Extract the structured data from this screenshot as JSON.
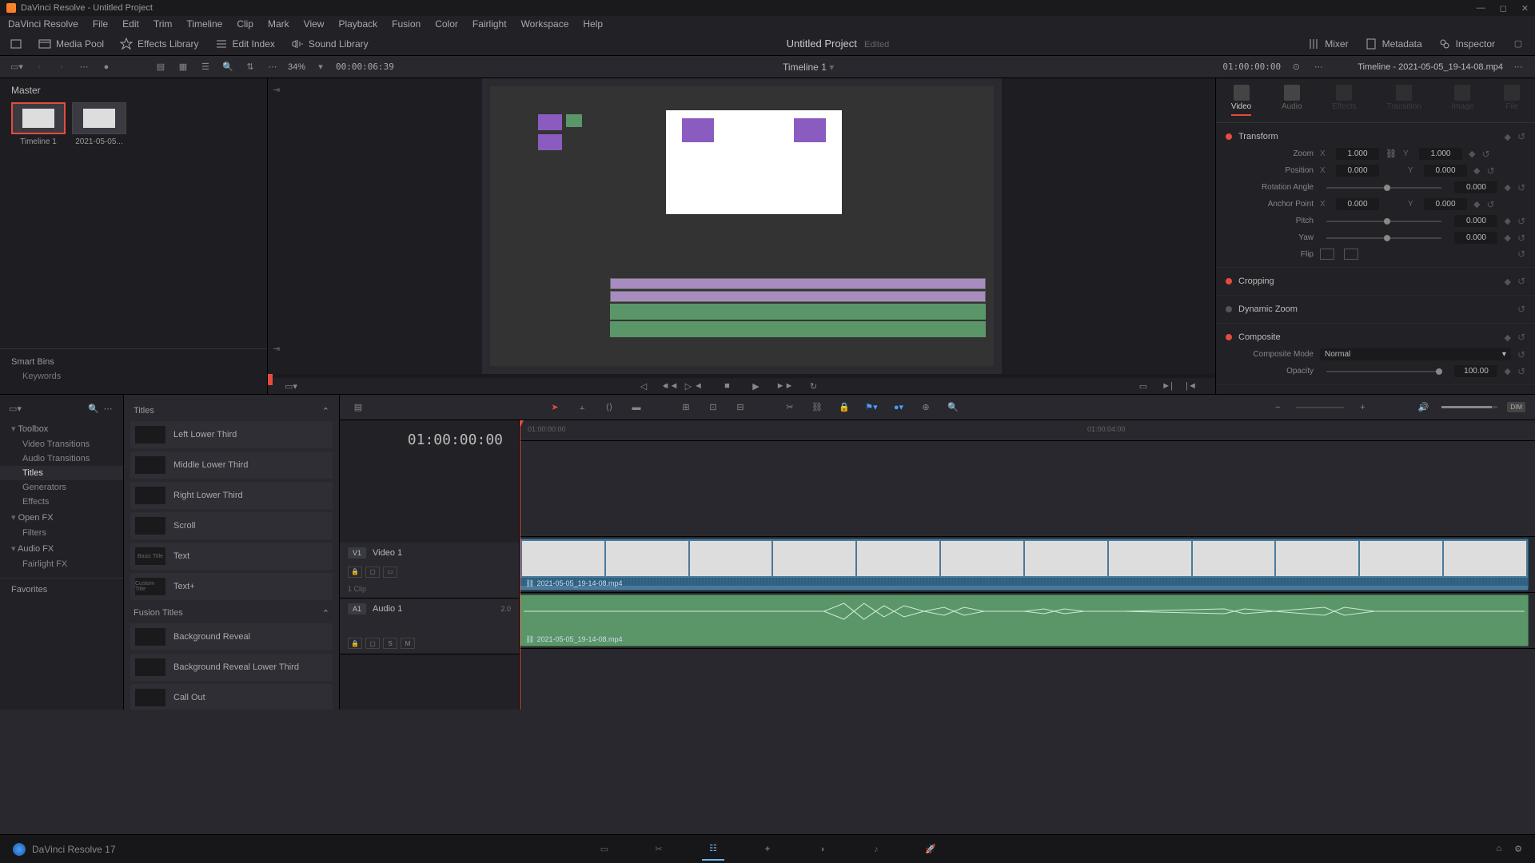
{
  "titlebar": {
    "app": "DaVinci Resolve",
    "project": "Untitled Project"
  },
  "menubar": [
    "DaVinci Resolve",
    "File",
    "Edit",
    "Trim",
    "Timeline",
    "Clip",
    "Mark",
    "View",
    "Playback",
    "Fusion",
    "Color",
    "Fairlight",
    "Workspace",
    "Help"
  ],
  "toolbar": {
    "media_pool": "Media Pool",
    "effects_library": "Effects Library",
    "edit_index": "Edit Index",
    "sound_library": "Sound Library",
    "project_title": "Untitled Project",
    "edited": "Edited",
    "mixer": "Mixer",
    "metadata": "Metadata",
    "inspector": "Inspector"
  },
  "subtoolbar": {
    "zoom": "34%",
    "timecode": "00:00:06:39",
    "timeline_name": "Timeline 1",
    "viewer_tc": "01:00:00:00"
  },
  "media": {
    "master": "Master",
    "items": [
      {
        "name": "Timeline 1"
      },
      {
        "name": "2021-05-05..."
      }
    ],
    "smart_bins": "Smart Bins",
    "keywords": "Keywords"
  },
  "inspector_panel": {
    "header": "Timeline - 2021-05-05_19-14-08.mp4",
    "tabs": [
      "Video",
      "Audio",
      "Effects",
      "Transition",
      "Image",
      "File"
    ],
    "transform": {
      "title": "Transform",
      "zoom": "Zoom",
      "zoom_x": "1.000",
      "zoom_y": "1.000",
      "position": "Position",
      "pos_x": "0.000",
      "pos_y": "0.000",
      "rotation": "Rotation Angle",
      "rot_val": "0.000",
      "anchor": "Anchor Point",
      "anc_x": "0.000",
      "anc_y": "0.000",
      "pitch": "Pitch",
      "pitch_val": "0.000",
      "yaw": "Yaw",
      "yaw_val": "0.000",
      "flip": "Flip"
    },
    "cropping": "Cropping",
    "dynamic_zoom": "Dynamic Zoom",
    "composite": {
      "title": "Composite",
      "mode_label": "Composite Mode",
      "mode": "Normal",
      "opacity_label": "Opacity",
      "opacity": "100.00"
    }
  },
  "effects": {
    "toolbox": "Toolbox",
    "categories": [
      "Video Transitions",
      "Audio Transitions",
      "Titles",
      "Generators",
      "Effects"
    ],
    "openfx": "Open FX",
    "filters": "Filters",
    "audiofx": "Audio FX",
    "fairlight": "Fairlight FX",
    "favorites": "Favorites",
    "titles_hdr": "Titles",
    "titles_list": [
      "Left Lower Third",
      "Middle Lower Third",
      "Right Lower Third",
      "Scroll",
      "Text",
      "Text+"
    ],
    "title_thumbs": [
      "",
      "",
      "",
      "",
      "Basic Title",
      "Custom Title"
    ],
    "fusion_hdr": "Fusion Titles",
    "fusion_list": [
      "Background Reveal",
      "Background Reveal Lower Third",
      "Call Out"
    ]
  },
  "timeline": {
    "playhead_tc": "01:00:00:00",
    "ruler": [
      "01:00:00:00",
      "01:00:04:00"
    ],
    "video_track": {
      "badge": "V1",
      "name": "Video 1",
      "clips": "1 Clip"
    },
    "audio_track": {
      "badge": "A1",
      "name": "Audio 1",
      "ch": "2.0"
    },
    "clip_name": "2021-05-05_19-14-08.mp4",
    "dim": "DIM"
  },
  "bottom": {
    "app": "DaVinci Resolve 17"
  }
}
